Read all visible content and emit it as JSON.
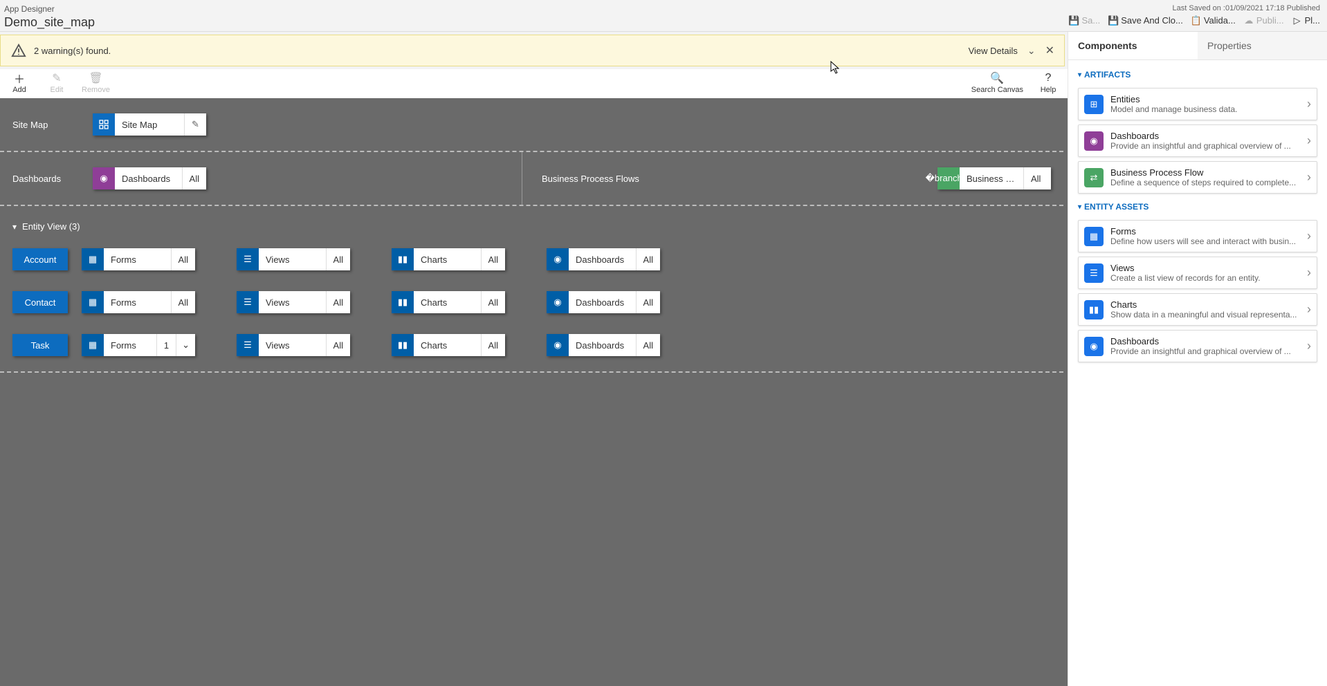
{
  "header": {
    "app_label": "App Designer",
    "app_name": "Demo_site_map",
    "last_saved": "Last Saved on :01/09/2021 17:18 Published",
    "actions": {
      "save": "Sa...",
      "save_close": "Save And Clo...",
      "validate": "Valida...",
      "publish": "Publi...",
      "play": "Pl..."
    }
  },
  "warning": {
    "text": "2 warning(s) found.",
    "view_details": "View Details"
  },
  "toolbar": {
    "add": "Add",
    "edit": "Edit",
    "remove": "Remove",
    "search": "Search Canvas",
    "help": "Help"
  },
  "canvas": {
    "sitemap_label": "Site Map",
    "sitemap_tile": "Site Map",
    "dashboards_label": "Dashboards",
    "dashboards_tile": "Dashboards",
    "dashboards_suffix": "All",
    "bpf_label": "Business Process Flows",
    "bpf_tile": "Business Proces...",
    "bpf_suffix": "All",
    "entity_view_label": "Entity View (3)",
    "entities": [
      {
        "name": "Account",
        "forms_count": "All"
      },
      {
        "name": "Contact",
        "forms_count": "All"
      },
      {
        "name": "Task",
        "forms_count": "1"
      }
    ],
    "col_forms": "Forms",
    "col_views": "Views",
    "col_charts": "Charts",
    "col_dashboards": "Dashboards",
    "all": "All"
  },
  "panel": {
    "tab_components": "Components",
    "tab_properties": "Properties",
    "group_artifacts": "ARTIFACTS",
    "group_entity_assets": "ENTITY ASSETS",
    "cards": {
      "entities": {
        "title": "Entities",
        "desc": "Model and manage business data."
      },
      "dashboards": {
        "title": "Dashboards",
        "desc": "Provide an insightful and graphical overview of ..."
      },
      "bpf": {
        "title": "Business Process Flow",
        "desc": "Define a sequence of steps required to complete..."
      },
      "forms": {
        "title": "Forms",
        "desc": "Define how users will see and interact with busin..."
      },
      "views": {
        "title": "Views",
        "desc": "Create a list view of records for an entity."
      },
      "charts": {
        "title": "Charts",
        "desc": "Show data in a meaningful and visual representa..."
      },
      "dash2": {
        "title": "Dashboards",
        "desc": "Provide an insightful and graphical overview of ..."
      }
    }
  }
}
